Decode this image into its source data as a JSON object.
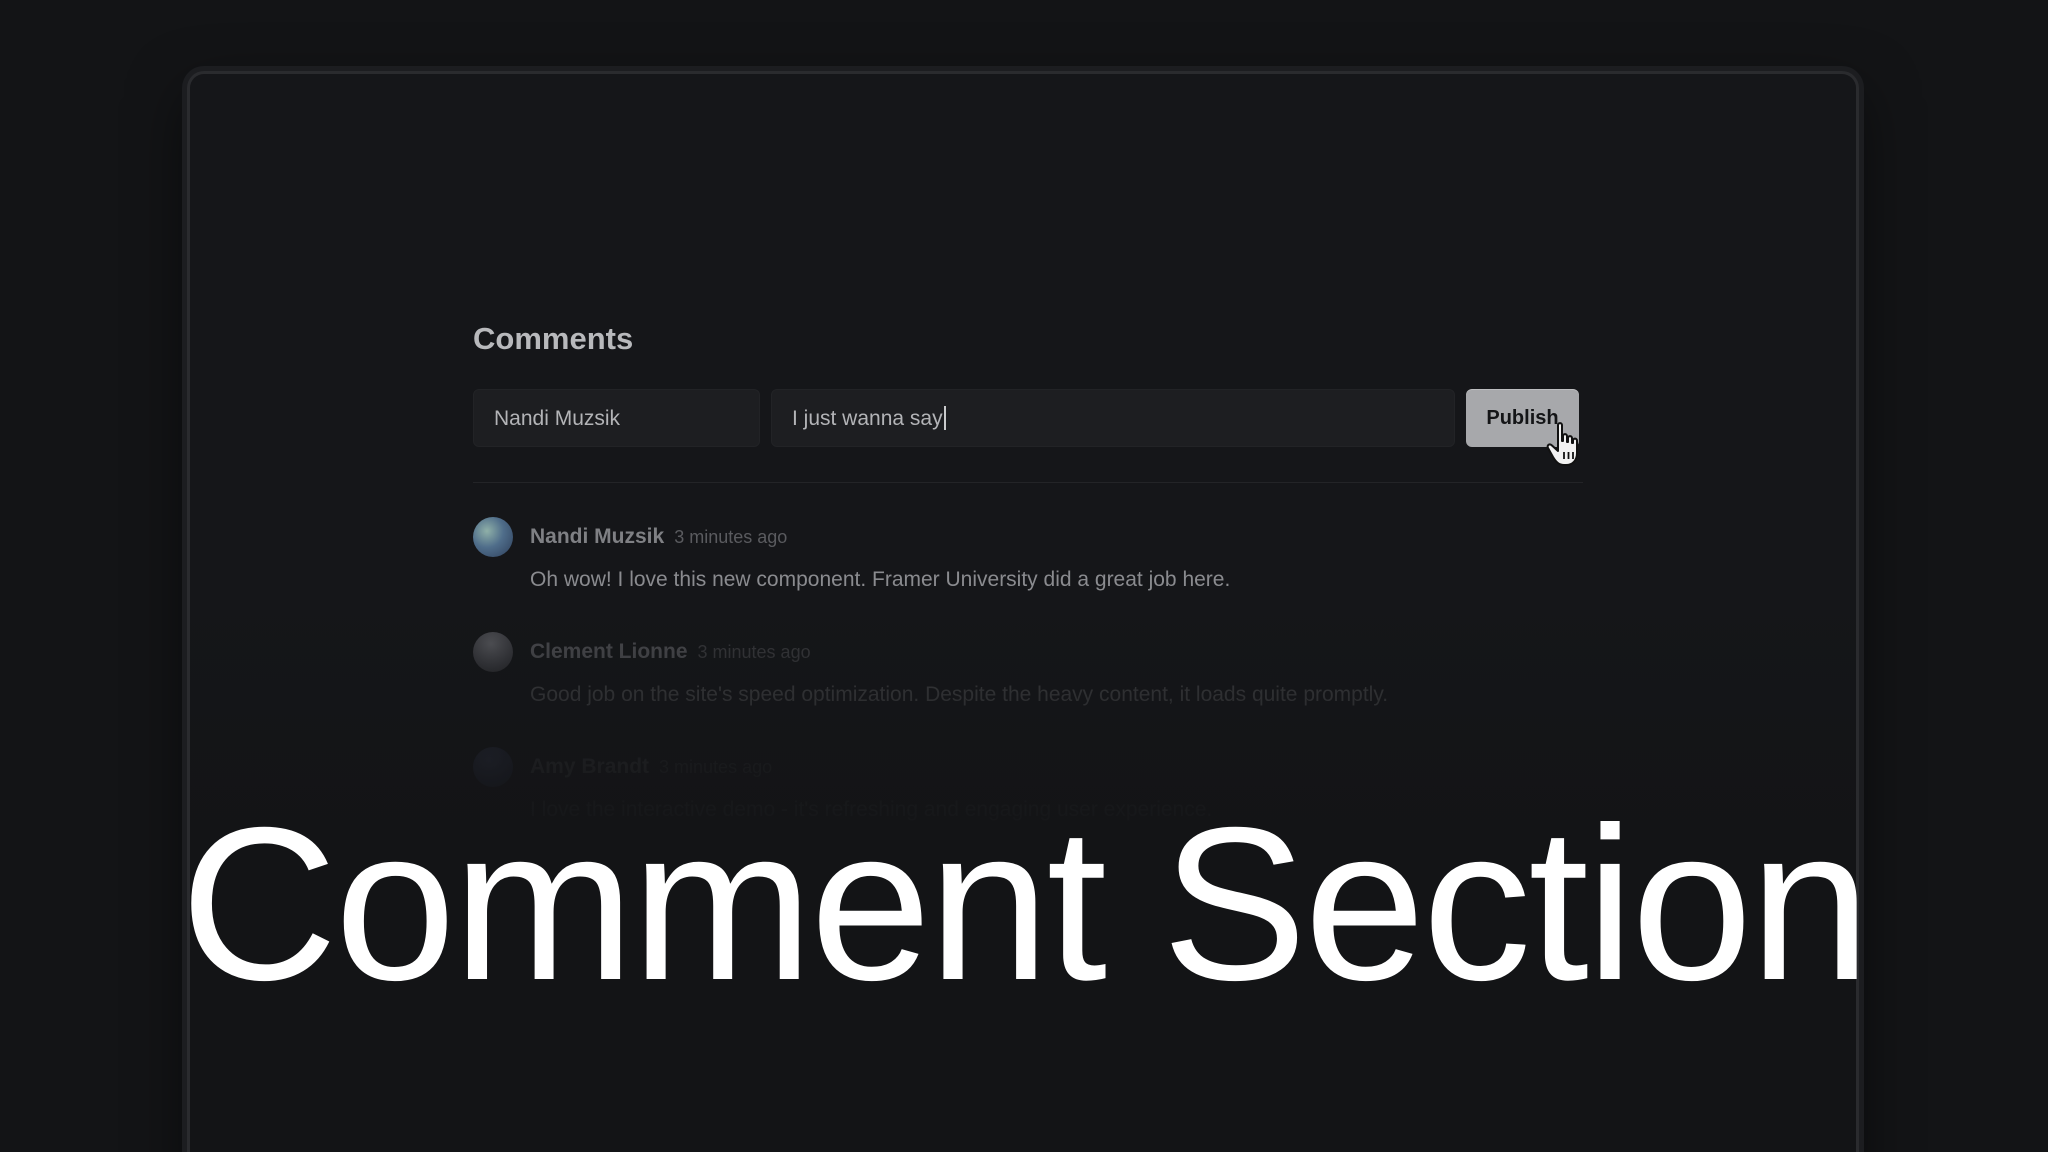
{
  "comments_section": {
    "title": "Comments",
    "composer": {
      "name_value": "Nandi Muzsik",
      "message_value": "I just wanna say",
      "publish_label": "Publish"
    },
    "comments": [
      {
        "author": "Nandi Muzsik",
        "time": "3 minutes ago",
        "text": "Oh wow! I love this new component. Framer University did a great job here."
      },
      {
        "author": "Clement Lionne",
        "time": "3 minutes ago",
        "text": "Good job on the site's speed optimization. Despite the heavy content, it loads quite promptly."
      },
      {
        "author": "Amy Brandt",
        "time": "3 minutes ago",
        "text": "I love the interactive demo - it's refreshing and engaging user experience."
      }
    ]
  },
  "overlay": {
    "headline": "Comment Section"
  },
  "colors": {
    "background": "#131416",
    "publish_button": "#a7a8ab",
    "headline_text": "#ffffff"
  },
  "icons": {
    "cursor": "hand-pointer-icon"
  }
}
